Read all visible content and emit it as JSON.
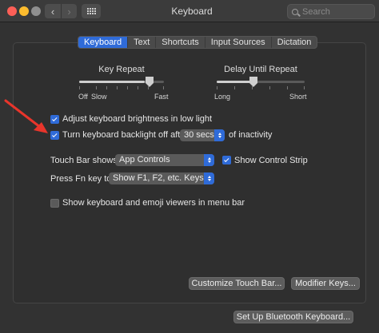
{
  "window": {
    "title": "Keyboard"
  },
  "titlebar": {
    "back_icon": "chevron-left-icon",
    "forward_icon": "chevron-right-icon",
    "show_all_icon": "grid-icon"
  },
  "search": {
    "placeholder": "Search",
    "value": ""
  },
  "tabs": [
    {
      "label": "Keyboard",
      "active": true
    },
    {
      "label": "Text",
      "active": false
    },
    {
      "label": "Shortcuts",
      "active": false
    },
    {
      "label": "Input Sources",
      "active": false
    },
    {
      "label": "Dictation",
      "active": false
    }
  ],
  "key_repeat": {
    "label": "Key Repeat",
    "min_label": "Off",
    "left_label": "Slow",
    "right_label": "Fast",
    "level": 0.78
  },
  "delay_until_repeat": {
    "label": "Delay Until Repeat",
    "left_label": "Long",
    "right_label": "Short",
    "level": 0.43
  },
  "options": {
    "adjust_brightness": {
      "label": "Adjust keyboard brightness in low light",
      "checked": true
    },
    "backlight_off": {
      "label_before": "Turn keyboard backlight off after",
      "selected": "30 secs",
      "label_after": "of inactivity",
      "checked": true
    }
  },
  "touch_bar": {
    "label": "Touch Bar shows",
    "selected": "App Controls",
    "control_strip": {
      "label": "Show Control Strip",
      "checked": true
    }
  },
  "fn_key": {
    "label": "Press Fn key to",
    "selected": "Show F1, F2, etc. Keys"
  },
  "viewers": {
    "label": "Show keyboard and emoji viewers in menu bar",
    "checked": false
  },
  "buttons": {
    "customize_touch_bar": "Customize Touch Bar...",
    "modifier_keys": "Modifier Keys...",
    "bluetooth_keyboard": "Set Up Bluetooth Keyboard..."
  },
  "colors": {
    "accent": "#2f6bd8",
    "annotation_arrow": "#e8352b"
  }
}
